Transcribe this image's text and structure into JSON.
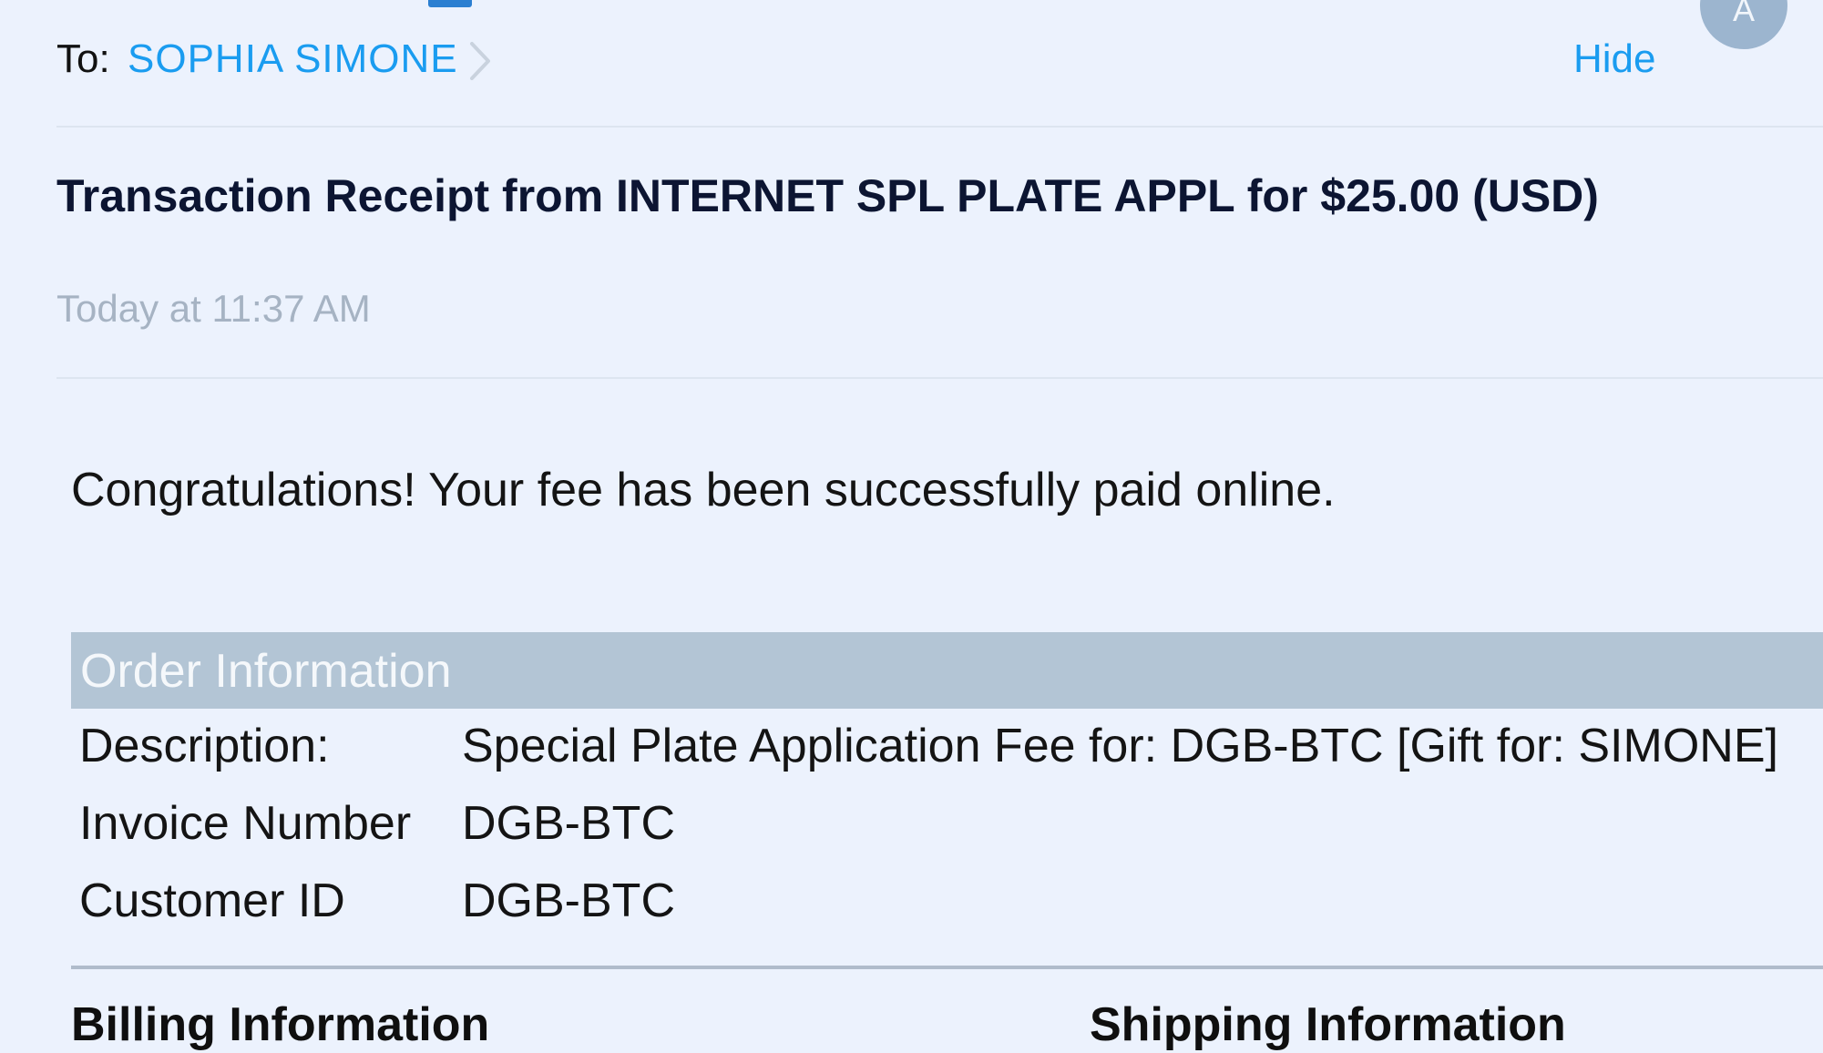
{
  "header": {
    "to_label": "To:",
    "recipient": "SOPHIA SIMONE",
    "hide_label": "Hide",
    "avatar_initial": "A"
  },
  "message": {
    "subject": "Transaction Receipt from INTERNET SPL PLATE APPL for $25.00 (USD)",
    "date": "Today at 11:37 AM"
  },
  "body": {
    "congrats": "Congratulations! Your fee has been successfully paid online.",
    "order_info": {
      "header": "Order Information",
      "rows": [
        {
          "label": "Description:",
          "value": "Special Plate Application Fee for: DGB-BTC [Gift for: SIMONE]"
        },
        {
          "label": "Invoice Number",
          "value": "DGB-BTC"
        },
        {
          "label": "Customer ID",
          "value": "DGB-BTC"
        }
      ]
    },
    "billing_header": "Billing Information",
    "shipping_header": "Shipping Information"
  },
  "colors": {
    "link": "#1a9cf0",
    "background": "#ecf2fd",
    "table_header": "#b3c5d5"
  }
}
